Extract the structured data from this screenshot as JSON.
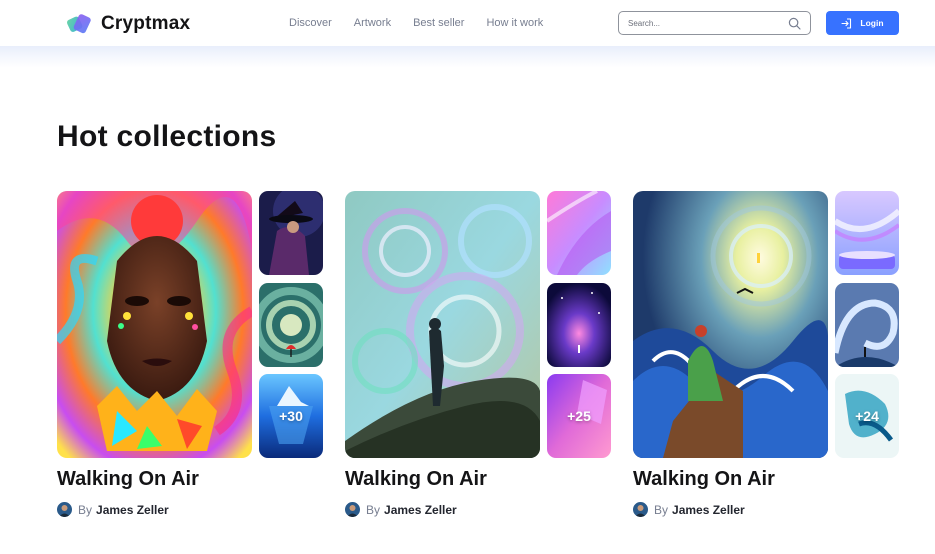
{
  "header": {
    "logo_text": "Cryptmax",
    "nav": [
      "Discover",
      "Artwork",
      "Best seller",
      "How it work"
    ],
    "search_placeholder": "Search...",
    "login_label": "Login",
    "accent": "#3772ff"
  },
  "section_title": "Hot collections",
  "collections": [
    {
      "title": "Walking On Air",
      "by": "By",
      "author": "James Zeller",
      "more_count": "+30",
      "main_art": "woman-portrait-psychedelic",
      "thumbs": [
        "witch-hat-figure",
        "spiral-red-umbrella",
        "iceberg"
      ]
    },
    {
      "title": "Walking On Air",
      "by": "By",
      "author": "James Zeller",
      "more_count": "+25",
      "main_art": "man-facing-swirl-sky",
      "thumbs": [
        "pink-gradient-wave",
        "galaxy-figure",
        "purple-crystal"
      ]
    },
    {
      "title": "Walking On Air",
      "by": "By",
      "author": "James Zeller",
      "more_count": "+24",
      "main_art": "woman-cliff-stormy-sea",
      "thumbs": [
        "glass-ribbon-podium",
        "wave-tunnel-figure",
        "blue-ink-splash"
      ]
    }
  ]
}
